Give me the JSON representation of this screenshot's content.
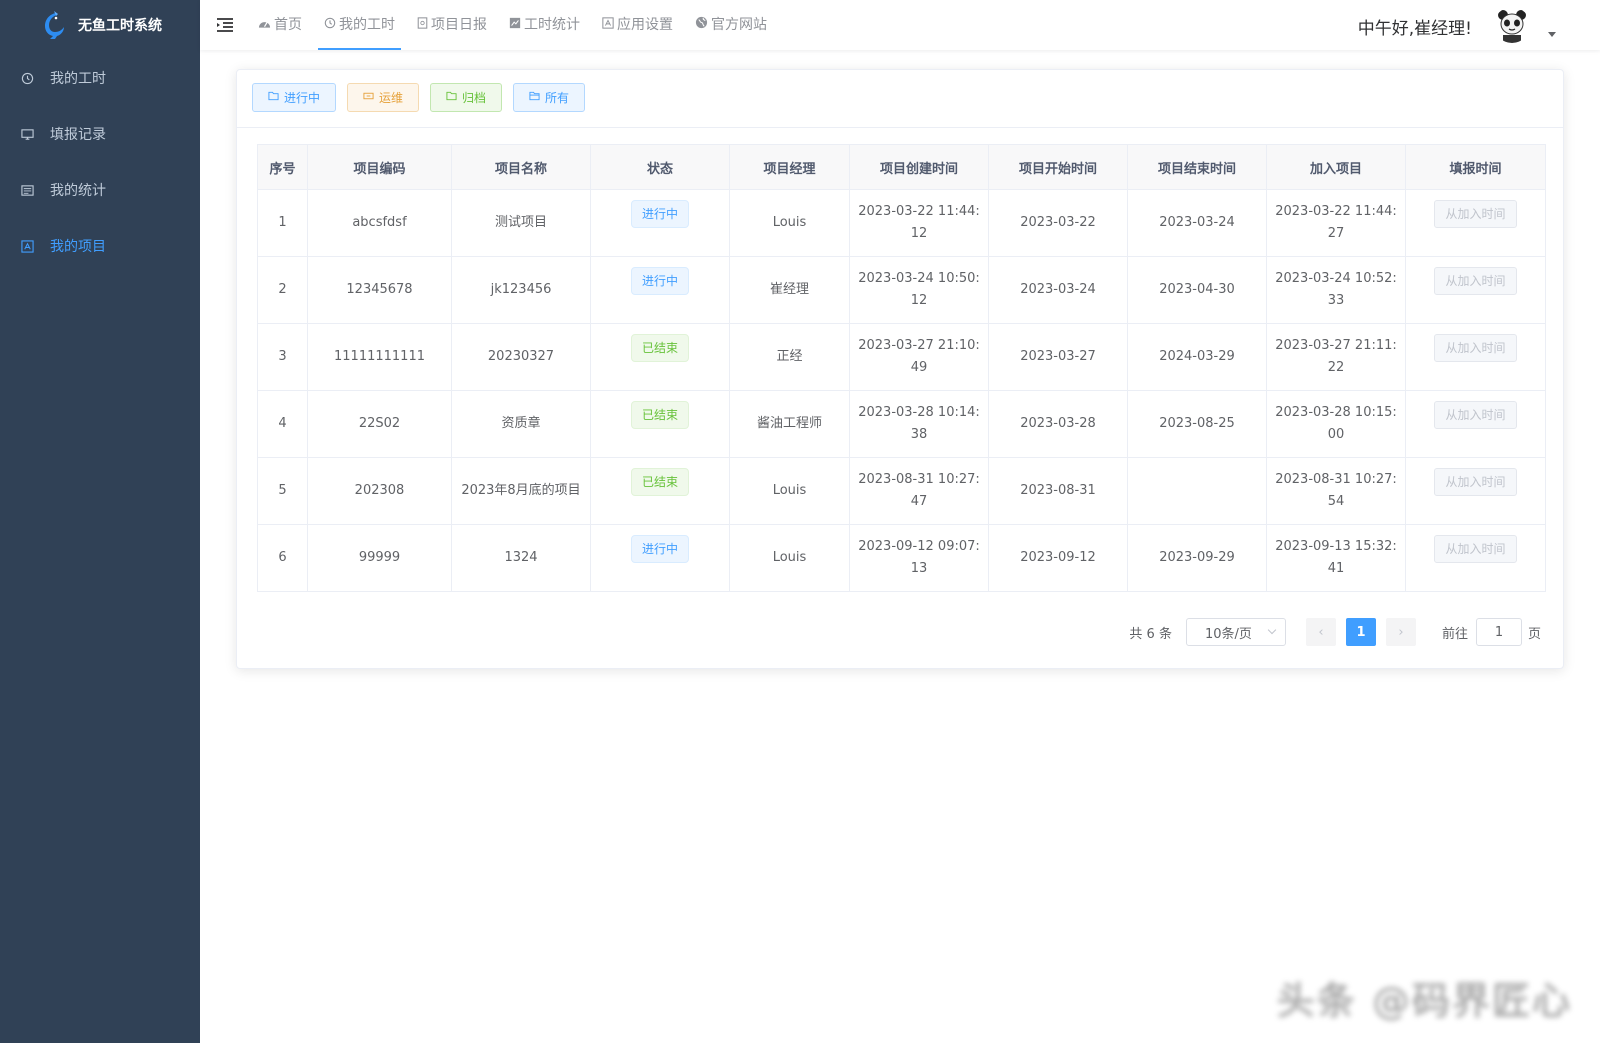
{
  "app": {
    "title": "无鱼工时系统"
  },
  "sidebar": {
    "items": [
      {
        "label": "我的工时",
        "icon": "clock-icon"
      },
      {
        "label": "填报记录",
        "icon": "monitor-icon"
      },
      {
        "label": "我的统计",
        "icon": "list-icon"
      },
      {
        "label": "我的项目",
        "icon": "project-icon",
        "active": true
      }
    ]
  },
  "header": {
    "tabs": [
      {
        "label": "首页",
        "icon": "dashboard-icon"
      },
      {
        "label": "我的工时",
        "icon": "clock-icon",
        "active": true
      },
      {
        "label": "项目日报",
        "icon": "doc-icon"
      },
      {
        "label": "工时统计",
        "icon": "chart-icon"
      },
      {
        "label": "应用设置",
        "icon": "settings-icon"
      },
      {
        "label": "官方网站",
        "icon": "globe-icon"
      }
    ],
    "greeting": "中午好,崔经理!"
  },
  "filters": [
    {
      "label": "进行中",
      "style": "blue"
    },
    {
      "label": "运维",
      "style": "orange"
    },
    {
      "label": "归档",
      "style": "green"
    },
    {
      "label": "所有",
      "style": "blue"
    }
  ],
  "table": {
    "columns": [
      "序号",
      "项目编码",
      "项目名称",
      "状态",
      "项目经理",
      "项目创建时间",
      "项目开始时间",
      "项目结束时间",
      "加入项目",
      "填报时间"
    ],
    "rows": [
      {
        "no": "1",
        "code": "abcsfdsf",
        "name": "测试项目",
        "status": "进行中",
        "status_style": "blue",
        "manager": "Louis",
        "created_a": "2023-03-22 11:44:",
        "created_b": "12",
        "start": "2023-03-22",
        "end": "2023-03-24",
        "joined_a": "2023-03-22 11:44:",
        "joined_b": "27",
        "action": "从加入时间"
      },
      {
        "no": "2",
        "code": "12345678",
        "name": "jk123456",
        "status": "进行中",
        "status_style": "blue",
        "manager": "崔经理",
        "created_a": "2023-03-24 10:50:",
        "created_b": "12",
        "start": "2023-03-24",
        "end": "2023-04-30",
        "joined_a": "2023-03-24 10:52:",
        "joined_b": "33",
        "action": "从加入时间"
      },
      {
        "no": "3",
        "code": "11111111111",
        "name": "20230327",
        "status": "已结束",
        "status_style": "green",
        "manager": "正经",
        "created_a": "2023-03-27 21:10:",
        "created_b": "49",
        "start": "2023-03-27",
        "end": "2024-03-29",
        "joined_a": "2023-03-27 21:11:",
        "joined_b": "22",
        "action": "从加入时间"
      },
      {
        "no": "4",
        "code": "22S02",
        "name": "资质章",
        "status": "已结束",
        "status_style": "green",
        "manager": "酱油工程师",
        "created_a": "2023-03-28 10:14:",
        "created_b": "38",
        "start": "2023-03-28",
        "end": "2023-08-25",
        "joined_a": "2023-03-28 10:15:",
        "joined_b": "00",
        "action": "从加入时间"
      },
      {
        "no": "5",
        "code": "202308",
        "name": "2023年8月底的项目",
        "status": "已结束",
        "status_style": "green",
        "manager": "Louis",
        "created_a": "2023-08-31 10:27:",
        "created_b": "47",
        "start": "2023-08-31",
        "end": "",
        "joined_a": "2023-08-31 10:27:",
        "joined_b": "54",
        "action": "从加入时间"
      },
      {
        "no": "6",
        "code": "99999",
        "name": "1324",
        "status": "进行中",
        "status_style": "blue",
        "manager": "Louis",
        "created_a": "2023-09-12 09:07:",
        "created_b": "13",
        "start": "2023-09-12",
        "end": "2023-09-29",
        "joined_a": "2023-09-13 15:32:",
        "joined_b": "41",
        "action": "从加入时间"
      }
    ]
  },
  "pagination": {
    "total": "共 6 条",
    "page_size": "10条/页",
    "current": "1",
    "goto_prefix": "前往",
    "goto_value": "1",
    "goto_suffix": "页"
  },
  "watermark": "头条 @码界匠心",
  "colors": {
    "sidebar_bg": "#304156",
    "accent": "#409eff",
    "success": "#67c23a",
    "warning": "#e6a23c"
  }
}
